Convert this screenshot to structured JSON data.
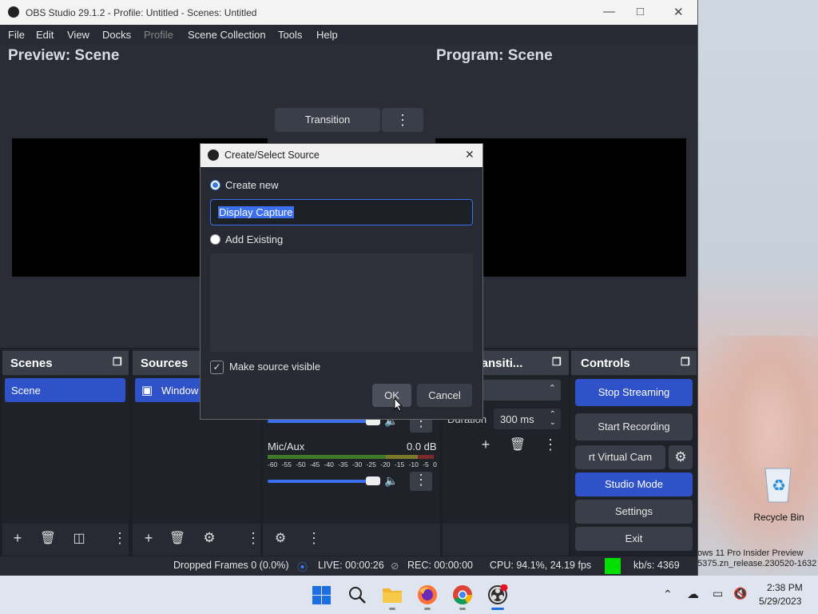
{
  "window": {
    "title": "OBS Studio 29.1.2 - Profile: Untitled - Scenes: Untitled",
    "minimize_icon": "minimize-icon",
    "maximize_icon": "maximize-icon",
    "close_icon": "close-icon"
  },
  "menu": [
    "File",
    "Edit",
    "View",
    "Docks",
    "Profile",
    "Scene Collection",
    "Tools",
    "Help"
  ],
  "preview": {
    "label": "Preview: Scene"
  },
  "program": {
    "label": "Program: Scene"
  },
  "transition_button": "Transition",
  "dialog": {
    "title": "Create/Select Source",
    "create_new_label": "Create new",
    "name_value": "Display Capture",
    "add_existing_label": "Add Existing",
    "make_visible_label": "Make source visible",
    "make_visible_checked": true,
    "ok_label": "OK",
    "cancel_label": "Cancel"
  },
  "scenes": {
    "title": "Scenes",
    "items": [
      "Scene"
    ]
  },
  "sources": {
    "title": "Sources",
    "items": [
      "Window"
    ]
  },
  "mixer": {
    "channel_name": "Mic/Aux",
    "channel_db": "0.0 dB",
    "scale": [
      "-60",
      "-55",
      "-50",
      "-45",
      "-40",
      "-35",
      "-30",
      "-25",
      "-20",
      "-15",
      "-10",
      "-5",
      "0"
    ]
  },
  "transitions": {
    "title": "e Transiti...",
    "duration_label": "Duration",
    "duration_value": "300 ms"
  },
  "controls": {
    "title": "Controls",
    "stop_streaming": "Stop Streaming",
    "start_recording": "Start Recording",
    "virtual_cam": "rt Virtual Cam",
    "studio_mode": "Studio Mode",
    "settings": "Settings",
    "exit": "Exit"
  },
  "status": {
    "dropped_frames": "Dropped Frames 0 (0.0%)",
    "live": "LIVE: 00:00:26",
    "rec": "REC: 00:00:00",
    "cpu": "CPU: 94.1%, 24.19 fps",
    "kbps": "kb/s: 4369",
    "health_color": "#00e000"
  },
  "desktop": {
    "recycle_bin_label": "Recycle Bin",
    "watermark_line1": "ows 11 Pro Insider Preview",
    "watermark_line2": "5375.zn_release.230520-1632"
  },
  "taskbar": {
    "time": "2:38 PM",
    "date": "5/29/2023",
    "apps": [
      "windows-start-icon",
      "search-icon",
      "file-explorer-icon",
      "firefox-icon",
      "chrome-icon",
      "obs-icon"
    ]
  }
}
